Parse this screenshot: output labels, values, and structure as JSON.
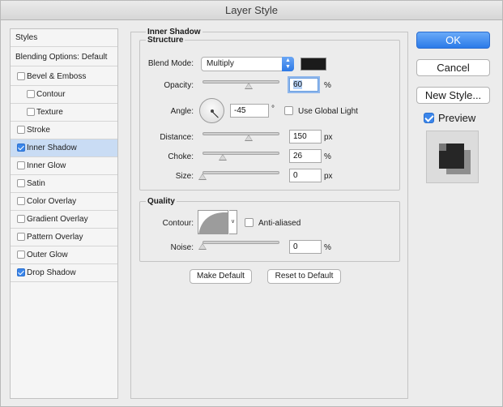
{
  "window": {
    "title": "Layer Style"
  },
  "styles_list": {
    "header": "Styles",
    "blending": "Blending Options: Default",
    "items": [
      {
        "label": "Bevel & Emboss",
        "checked": false,
        "indent": false
      },
      {
        "label": "Contour",
        "checked": false,
        "indent": true
      },
      {
        "label": "Texture",
        "checked": false,
        "indent": true
      },
      {
        "label": "Stroke",
        "checked": false,
        "indent": false
      },
      {
        "label": "Inner Shadow",
        "checked": true,
        "indent": false,
        "selected": true
      },
      {
        "label": "Inner Glow",
        "checked": false,
        "indent": false
      },
      {
        "label": "Satin",
        "checked": false,
        "indent": false
      },
      {
        "label": "Color Overlay",
        "checked": false,
        "indent": false
      },
      {
        "label": "Gradient Overlay",
        "checked": false,
        "indent": false
      },
      {
        "label": "Pattern Overlay",
        "checked": false,
        "indent": false
      },
      {
        "label": "Outer Glow",
        "checked": false,
        "indent": false
      },
      {
        "label": "Drop Shadow",
        "checked": true,
        "indent": false
      }
    ]
  },
  "panel": {
    "title": "Inner Shadow",
    "structure": {
      "title": "Structure",
      "blend_mode_label": "Blend Mode:",
      "blend_mode_value": "Multiply",
      "shadow_color": "#1b1b1b",
      "opacity_label": "Opacity:",
      "opacity_value": "60",
      "opacity_unit": "%",
      "opacity_level": 0.6,
      "angle_label": "Angle:",
      "angle_value": "-45",
      "angle_unit": "°",
      "global_light_label": "Use Global Light",
      "global_light_checked": false,
      "distance_label": "Distance:",
      "distance_value": "150",
      "distance_unit": "px",
      "distance_level": 0.6,
      "choke_label": "Choke:",
      "choke_value": "26",
      "choke_unit": "%",
      "choke_level": 0.26,
      "size_label": "Size:",
      "size_value": "0",
      "size_unit": "px",
      "size_level": 0
    },
    "quality": {
      "title": "Quality",
      "contour_label": "Contour:",
      "anti_aliased_label": "Anti-aliased",
      "anti_aliased_checked": false,
      "noise_label": "Noise:",
      "noise_value": "0",
      "noise_unit": "%",
      "noise_level": 0
    },
    "make_default": "Make Default",
    "reset_default": "Reset to Default"
  },
  "actions": {
    "ok": "OK",
    "cancel": "Cancel",
    "new_style": "New Style...",
    "preview_label": "Preview",
    "preview_checked": true
  },
  "colors": {
    "accent": "#3b86ea",
    "selection": "#c9dcf4"
  }
}
